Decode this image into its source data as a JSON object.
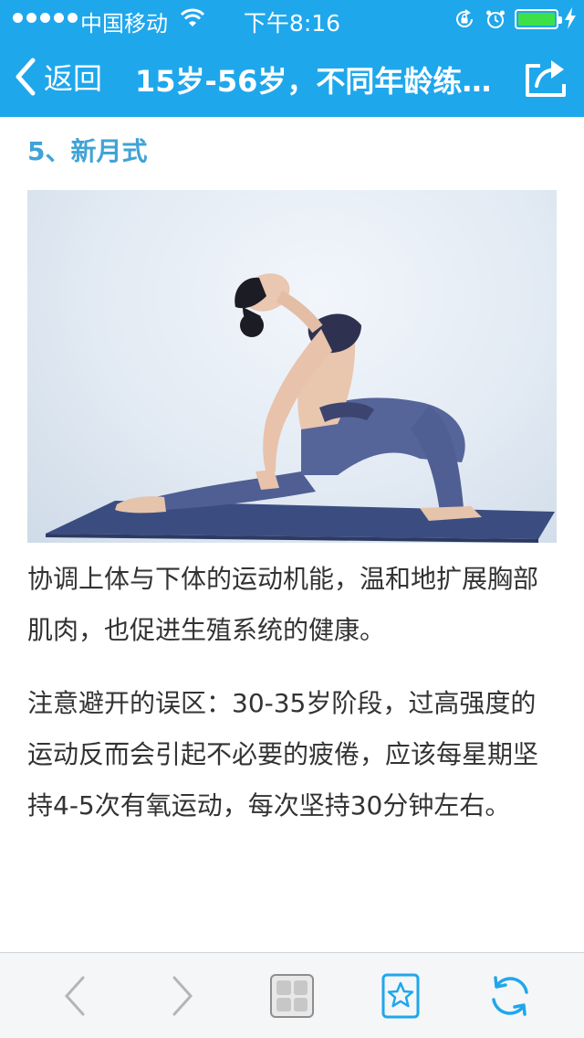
{
  "status_bar": {
    "carrier": "中国移动",
    "time": "下午8:16",
    "battery_level": 1.0,
    "colors": {
      "background": "#1fa7ec",
      "battery_fill": "#3ee04a"
    }
  },
  "nav": {
    "back_label": "返回",
    "title": "15岁-56岁，不同年龄练…",
    "icons": {
      "back": "chevron-left-icon",
      "share": "share-icon"
    }
  },
  "article": {
    "section_heading": "5、新月式",
    "paragraph_1": "协调上体与下体的运动机能，温和地扩展胸部肌肉，也促进生殖系统的健康。",
    "paragraph_2": "注意避开的误区：30-35岁阶段，过高强度的运动反而会引起不必要的疲倦，应该每星期坚持4-5次有氧运动，每次坚持30分钟左右。",
    "colors": {
      "heading": "#3fa3d6",
      "body_text": "#333333"
    }
  },
  "toolbar": {
    "icons": [
      "chevron-left-icon",
      "chevron-right-icon",
      "tabs-icon",
      "favorite-star-icon",
      "refresh-icon"
    ],
    "colors": {
      "inactive": "#b5b5b5",
      "active": "#1fa7ec"
    }
  }
}
